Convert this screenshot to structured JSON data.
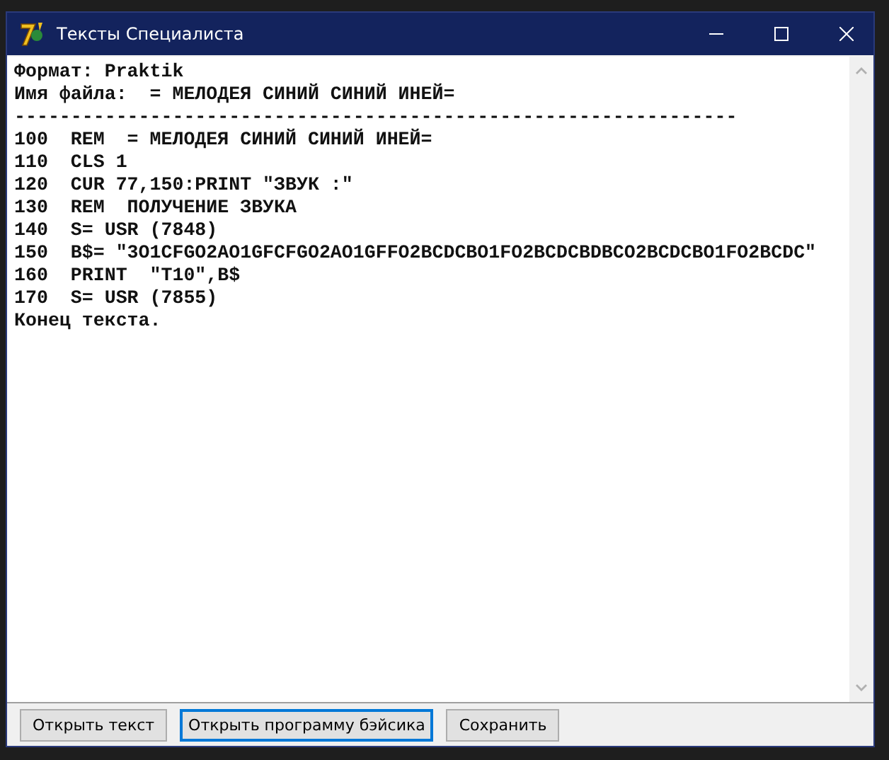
{
  "window": {
    "title": "Тексты Специалиста"
  },
  "text_lines": [
    "Формат: Praktik",
    "Имя файла:  = МЕЛОДЕЯ СИНИЙ СИНИЙ ИНЕЙ=",
    "----------------------------------------------------------------",
    "100  REM  = МЕЛОДЕЯ СИНИЙ СИНИЙ ИНЕЙ=",
    "110  CLS 1",
    "120  CUR 77,150:PRINT \"ЗВУК :\"",
    "130  REM  ПОЛУЧЕНИЕ ЗВУКА",
    "140  S= USR (7848)",
    "150  B$= \"3O1CFGO2AO1GFCFGO2AO1GFFO2BCDCBO1FO2BCDCBDBCO2BCDCBO1FO2BCDC\"",
    "160  PRINT  \"T10\",B$",
    "170  S= USR (7855)",
    "Конец текста."
  ],
  "buttons": [
    {
      "label": "Открыть текст",
      "selected": false
    },
    {
      "label": "Открыть программу бэйсика",
      "selected": true
    },
    {
      "label": "Сохранить",
      "selected": false
    }
  ]
}
